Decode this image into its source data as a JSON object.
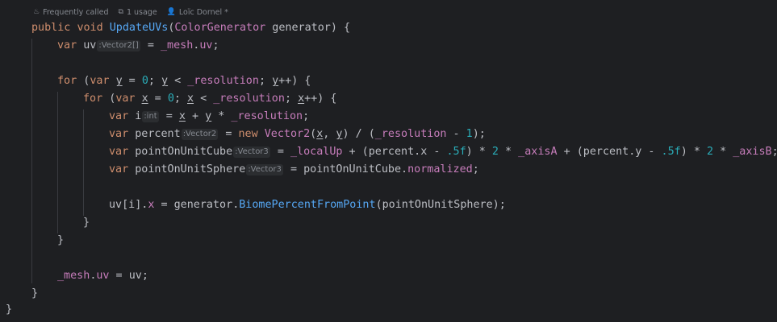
{
  "meta": {
    "called": "Frequently called",
    "usage": "1 usage",
    "author": "Loïc Dornel *"
  },
  "code": {
    "public": "public",
    "void": "void",
    "method_name": "UpdateUVs",
    "paren_open": "(",
    "param_type": "ColorGenerator",
    "param_rest": " generator) {",
    "var": "var",
    "uv": " uv",
    "hint_vector2_arr": ":Vector2[]",
    "eq": " = ",
    "mesh": "_mesh",
    "dot": ".",
    "uv_field": "uv",
    "semi": ";",
    "for": "for",
    "for_open": " (",
    "y": "y",
    "x": "x",
    "zero": "0",
    "lt": "; ",
    "cmp": " < ",
    "resolution": "_resolution",
    "inc": "++) {",
    "i": " i",
    "hint_int": ":int",
    "plus": " + ",
    "times": " * ",
    "percent": " percent",
    "hint_vector2": ":Vector2",
    "new": "new",
    "vector2": "Vector2",
    "one": "1",
    "poc": " pointOnUnitCube",
    "hint_vector3": ":Vector3",
    "localup": "_localUp",
    "half": ".5f",
    "two": "2",
    "axisA": "_axisA",
    "axisB": "_axisB",
    "pos": " pointOnUnitSphere",
    "normalized": "normalized",
    "gen": "generator",
    "biome": "BiomePercentFromPoint",
    "close_brace": "}"
  }
}
